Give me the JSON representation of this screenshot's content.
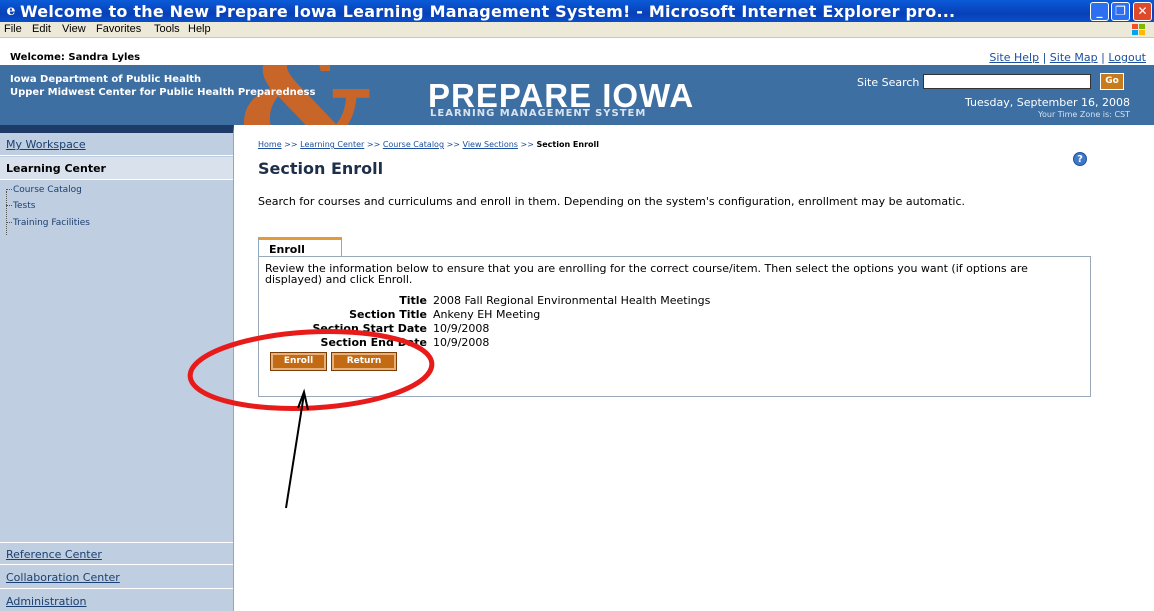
{
  "window": {
    "title": "Welcome to the New Prepare Iowa Learning Management System! - Microsoft Internet Explorer pro...",
    "icon": "ie-icon"
  },
  "menu": [
    "File",
    "Edit",
    "View",
    "Favorites",
    "Tools",
    "Help"
  ],
  "welcome": "Welcome: Sandra Lyles",
  "top_links": [
    "Site Help",
    "Site Map",
    "Logout"
  ],
  "header": {
    "org_line1": "Iowa Department of Public Health",
    "org_line2": "Upper Midwest Center for Public Health Preparedness",
    "amp": "&",
    "brand": "PREPARE IOWA",
    "brand_sub": "LEARNING MANAGEMENT SYSTEM",
    "search_label": "Site Search",
    "search_value": "",
    "go_label": "Go",
    "date": "Tuesday, September 16, 2008",
    "timezone": "Your Time Zone is: CST",
    "colors": {
      "banner": "#3d6fa3",
      "amp": "#c8662a",
      "accent": "#c26a14"
    }
  },
  "nav": {
    "workspace": "My Workspace",
    "learning_center": "Learning Center",
    "learning_items": [
      "Course Catalog",
      "Tests",
      "Training Facilities"
    ],
    "bottom": [
      "Reference Center",
      "Collaboration Center",
      "Administration"
    ]
  },
  "breadcrumb": {
    "items": [
      "Home",
      "Learning Center",
      "Course Catalog",
      "View Sections"
    ],
    "separator": ">>",
    "current": "Section Enroll"
  },
  "page": {
    "title": "Section Enroll",
    "description": "Search for courses and curriculums and enroll in them. Depending on the system's configuration, enrollment may be automatic.",
    "help_icon": "help-icon"
  },
  "enroll": {
    "tab": "Enroll",
    "instructions": "Review the information below to ensure that you are enrolling for the correct course/item. Then select the options you want (if options are displayed) and click Enroll.",
    "fields": [
      {
        "label": "Title",
        "value": "2008 Fall Regional Environmental Health Meetings"
      },
      {
        "label": "Section Title",
        "value": "Ankeny EH Meeting"
      },
      {
        "label": "Section Start Date",
        "value": "10/9/2008"
      },
      {
        "label": "Section End Date",
        "value": "10/9/2008"
      }
    ],
    "enroll_button": "Enroll",
    "return_button": "Return"
  }
}
